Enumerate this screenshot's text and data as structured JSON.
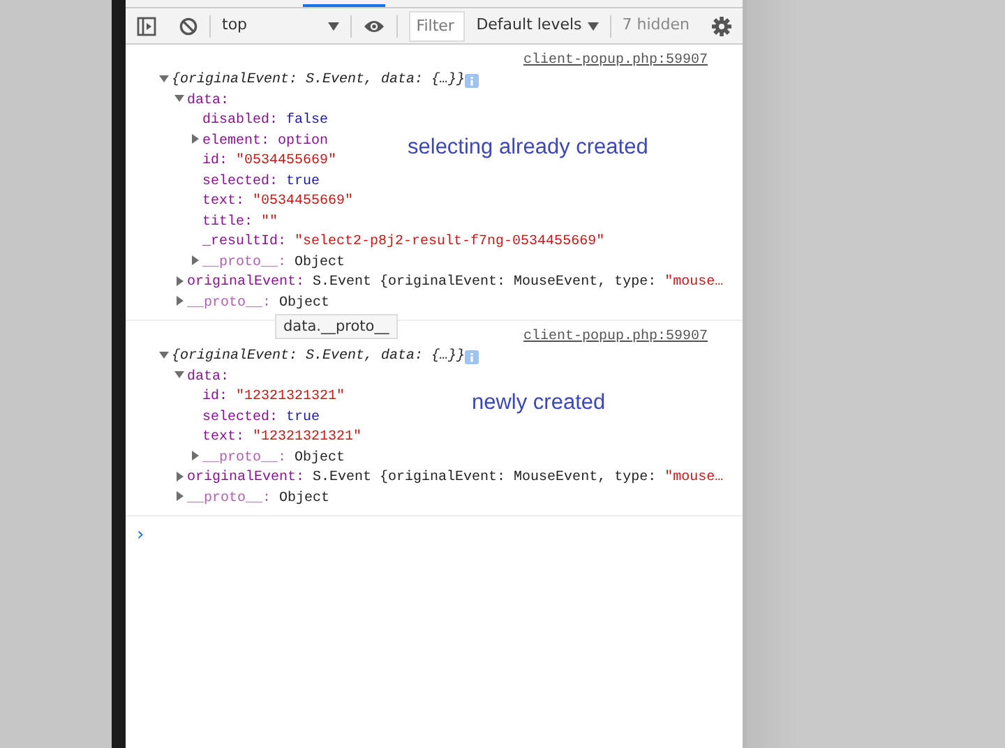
{
  "toolbar": {
    "context": "top",
    "filter_placeholder": "Filter",
    "levels": "Default levels",
    "hidden_count": "7 hidden"
  },
  "messages": [
    {
      "source": "client-popup.php:59907",
      "summary": "{originalEvent: S.Event, data: {…}}",
      "expanded": true,
      "annotation": "selecting already created",
      "tooltip": "data.__proto__",
      "children": [
        {
          "key": "data:",
          "kind": "object",
          "expanded": true,
          "children": [
            {
              "key": "disabled:",
              "kind": "leaf",
              "value": [
                {
                  "text": "false",
                  "kind": "keyword"
                }
              ]
            },
            {
              "key": "element:",
              "kind": "object",
              "expanded": false,
              "value": [
                {
                  "text": "option",
                  "kind": "name"
                }
              ]
            },
            {
              "key": "id:",
              "kind": "leaf",
              "value": [
                {
                  "text": "\"0534455669\"",
                  "kind": "string"
                }
              ]
            },
            {
              "key": "selected:",
              "kind": "leaf",
              "value": [
                {
                  "text": "true",
                  "kind": "keyword"
                }
              ]
            },
            {
              "key": "text:",
              "kind": "leaf",
              "value": [
                {
                  "text": "\"0534455669\"",
                  "kind": "string"
                }
              ]
            },
            {
              "key": "title:",
              "kind": "leaf",
              "value": [
                {
                  "text": "\"\"",
                  "kind": "string"
                }
              ]
            },
            {
              "key": "_resultId:",
              "kind": "leaf",
              "value": [
                {
                  "text": "\"select2-p8j2-result-f7ng-0534455669\"",
                  "kind": "string"
                }
              ]
            },
            {
              "key": "__proto__:",
              "kind": "proto",
              "expanded": false,
              "value": [
                {
                  "text": "Object",
                  "kind": "plain"
                }
              ]
            }
          ]
        },
        {
          "key": "originalEvent:",
          "kind": "object",
          "expanded": false,
          "value": [
            {
              "text": "S.Event {originalEvent: MouseEvent, type: ",
              "kind": "plain"
            },
            {
              "text": "\"mouse…",
              "kind": "string"
            }
          ]
        },
        {
          "key": "__proto__:",
          "kind": "proto",
          "expanded": false,
          "value": [
            {
              "text": "Object",
              "kind": "plain"
            }
          ]
        }
      ]
    },
    {
      "source": "client-popup.php:59907",
      "summary": "{originalEvent: S.Event, data: {…}}",
      "expanded": true,
      "annotation": "newly created",
      "children": [
        {
          "key": "data:",
          "kind": "object",
          "expanded": true,
          "children": [
            {
              "key": "id:",
              "kind": "leaf",
              "value": [
                {
                  "text": "\"12321321321\"",
                  "kind": "string"
                }
              ]
            },
            {
              "key": "selected:",
              "kind": "leaf",
              "value": [
                {
                  "text": "true",
                  "kind": "keyword"
                }
              ]
            },
            {
              "key": "text:",
              "kind": "leaf",
              "value": [
                {
                  "text": "\"12321321321\"",
                  "kind": "string"
                }
              ]
            },
            {
              "key": "__proto__:",
              "kind": "proto",
              "expanded": false,
              "value": [
                {
                  "text": "Object",
                  "kind": "plain"
                }
              ]
            }
          ]
        },
        {
          "key": "originalEvent:",
          "kind": "object",
          "expanded": false,
          "value": [
            {
              "text": "S.Event {originalEvent: MouseEvent, type: ",
              "kind": "plain"
            },
            {
              "text": "\"mouse…",
              "kind": "string"
            }
          ]
        },
        {
          "key": "__proto__:",
          "kind": "proto",
          "expanded": false,
          "value": [
            {
              "text": "Object",
              "kind": "plain"
            }
          ]
        }
      ]
    }
  ],
  "prompt": "›"
}
